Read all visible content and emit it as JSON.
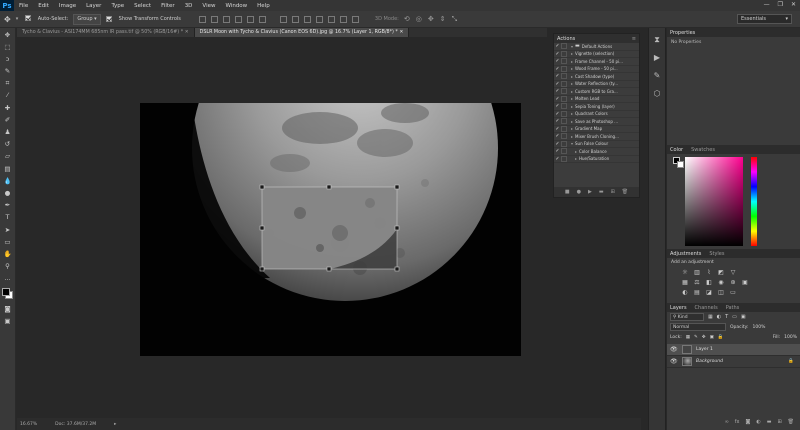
{
  "app": {
    "logo": "Ps"
  },
  "menu": [
    "File",
    "Edit",
    "Image",
    "Layer",
    "Type",
    "Select",
    "Filter",
    "3D",
    "View",
    "Window",
    "Help"
  ],
  "window_controls": [
    "—",
    "❐",
    "✕"
  ],
  "options": {
    "auto_select_label": "Auto-Select:",
    "auto_select_value": "Group",
    "transform_label": "Show Transform Controls",
    "mode_3d_label": "3D Mode:",
    "workspace": "Essentials"
  },
  "tabs": [
    {
      "label": "Tycho & Clavius - ASI174MM 685nm IR pass.tif @ 50% (RGB/16#) *",
      "active": false
    },
    {
      "label": "DSLR Moon with Tycho & Clavius (Canon EOS 6D).jpg @ 16.7% (Layer 1, RGB/8*) *",
      "active": true
    }
  ],
  "status": {
    "zoom": "16.67%",
    "doc": "Doc: 37.6M/37.2M"
  },
  "actions_panel": {
    "title": "Actions",
    "set_name": "Default Actions",
    "items": [
      "Vignette (selection)",
      "Frame Channel - 50 pi...",
      "Wood Frame - 50 pi...",
      "Cast Shadow (type)",
      "Water Reflection (ty...",
      "Custom RGB to Gra...",
      "Molten Lead",
      "Sepia Toning (layer)",
      "Quadrant Colors",
      "Save as Photoshop ...",
      "Gradient Map",
      "Mixer Brush Cloning...",
      "Sun False Colour",
      "Color Balance",
      "Hue/Saturation"
    ]
  },
  "properties": {
    "title": "Properties",
    "empty": "No Properties"
  },
  "color_panel": {
    "tabs": [
      "Color",
      "Swatches"
    ]
  },
  "adjustments": {
    "tabs": [
      "Adjustments",
      "Styles"
    ],
    "hint": "Add an adjustment"
  },
  "layers": {
    "tabs": [
      "Layers",
      "Channels",
      "Paths"
    ],
    "kind": "Kind",
    "blend_mode": "Normal",
    "opacity_label": "Opacity:",
    "opacity": "100%",
    "lock_label": "Lock:",
    "fill_label": "Fill:",
    "fill": "100%",
    "items": [
      "Layer 1",
      "Background"
    ]
  },
  "colors": {
    "accent": "#31a8ff",
    "panel": "#3a3a3a",
    "canvas_bg": "#282828"
  }
}
